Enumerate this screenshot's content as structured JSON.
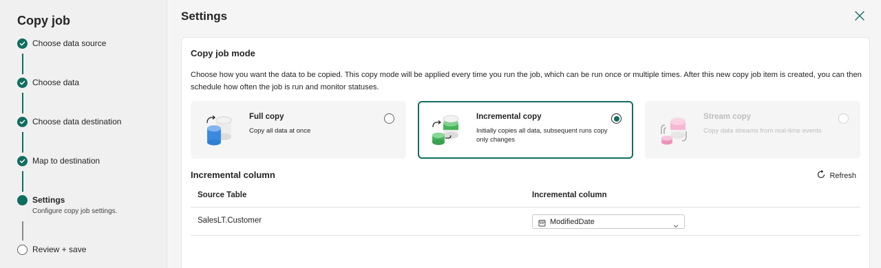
{
  "sidebar": {
    "title": "Copy job",
    "steps": [
      {
        "label": "Choose data source",
        "state": "done"
      },
      {
        "label": "Choose data",
        "state": "done"
      },
      {
        "label": "Choose data destination",
        "state": "done"
      },
      {
        "label": "Map to destination",
        "state": "done"
      },
      {
        "label": "Settings",
        "state": "current",
        "sublabel": "Configure copy job settings."
      },
      {
        "label": "Review + save",
        "state": "todo"
      }
    ]
  },
  "main": {
    "title": "Settings",
    "mode": {
      "title": "Copy job mode",
      "description": "Choose how you want the data to be copied. This copy mode will be applied every time you run the job, which can be run once or multiple times. After this new copy job item is created, you can then schedule how often the job is run and monitor statuses.",
      "cards": [
        {
          "title": "Full copy",
          "description": "Copy all data at once",
          "selected": false,
          "disabled": false
        },
        {
          "title": "Incremental copy",
          "description": "Initially copies all data, subsequent runs copy only changes",
          "selected": true,
          "disabled": false
        },
        {
          "title": "Stream copy",
          "description": "Copy data streams from real-time events",
          "selected": false,
          "disabled": true
        }
      ]
    },
    "incremental": {
      "title": "Incremental column",
      "refresh_label": "Refresh",
      "columns": [
        "Source Table",
        "Incremental column"
      ],
      "rows": [
        {
          "source_table": "SalesLT.Customer",
          "incremental_column": "ModifiedDate"
        }
      ]
    }
  },
  "colors": {
    "accent": "#0f6d5f",
    "blue": "#2f7fd6",
    "green": "#46b35a",
    "pink": "#f2a4c8"
  },
  "icons": [
    "check-icon",
    "close-icon",
    "refresh-icon",
    "calendar-icon",
    "chevron-down-icon"
  ]
}
